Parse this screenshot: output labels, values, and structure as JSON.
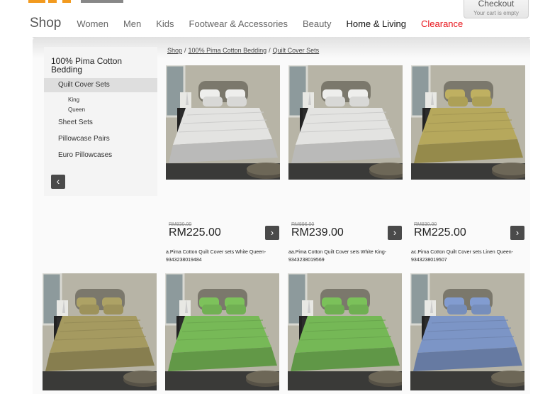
{
  "header": {
    "checkout_label": "Checkout",
    "cart_status": "Your cart is empty"
  },
  "nav": {
    "shop": "Shop",
    "items": [
      "Women",
      "Men",
      "Kids",
      "Footwear & Accessories",
      "Beauty",
      "Home & Living",
      "Clearance"
    ]
  },
  "breadcrumb": {
    "items": [
      "Shop",
      "100% Pima Cotton Bedding",
      "Quilt Cover Sets"
    ],
    "separator": "/"
  },
  "sidebar": {
    "title": "100% Pima Cotton Bedding",
    "current": "Quilt Cover Sets",
    "sub_items": [
      "King",
      "Queen"
    ],
    "links": [
      "Sheet Sets",
      "Pillowcase Pairs",
      "Euro Pillowcases"
    ],
    "back_icon": "chevron-left-icon"
  },
  "products": [
    {
      "old_price": "RM830.00",
      "price": "RM225.00",
      "name": "a.Pima Cotton Quilt Cover sets White Queen-9343238019484",
      "color": "#e3e3e1"
    },
    {
      "old_price": "RM896.00",
      "price": "RM239.00",
      "name": "aa.Pima Cotton Quilt Cover sets White King-9343238019569",
      "color": "#e3e3e1"
    },
    {
      "old_price": "RM830.00",
      "price": "RM225.00",
      "name": "ac.Pima Cotton Quilt Cover sets Linen Queen-9343238019507",
      "color": "#b6a85c"
    },
    {
      "color": "#a59a60"
    },
    {
      "color": "#77b957"
    },
    {
      "color": "#75b856"
    },
    {
      "color": "#7c95c6"
    }
  ],
  "arrow_icon": "chevron-right-icon",
  "colors": {
    "clearance": "#e8141b",
    "button": "#4a4a4a"
  }
}
